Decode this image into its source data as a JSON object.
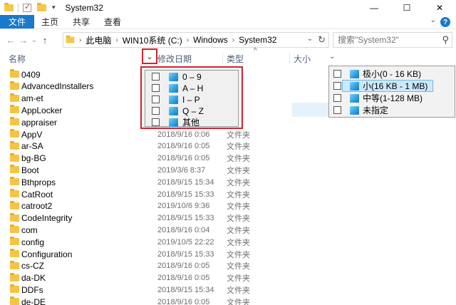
{
  "window": {
    "title": "System32",
    "controls": {
      "minimize": "—",
      "maximize": "☐",
      "close": "✕"
    }
  },
  "ribbon": {
    "tabs": [
      "文件",
      "主页",
      "共享",
      "查看"
    ],
    "help_label": "?",
    "collapse_label": "⌄"
  },
  "nav": {
    "back": "←",
    "forward": "→",
    "recent": "⌄",
    "up": "↑",
    "breadcrumbs": [
      "此电脑",
      "WIN10系统 (C:)",
      "Windows",
      "System32"
    ],
    "crumb_sep": "›",
    "dropdown": "⌄",
    "refresh": "↻"
  },
  "search": {
    "placeholder": "搜索\"System32\"",
    "icon": "⚲"
  },
  "columns": {
    "name": "名称",
    "date": "修改日期",
    "type": "类型",
    "size": "大小",
    "filter_caret": "⌄",
    "sort_caret": "^"
  },
  "files": [
    {
      "name": "0409",
      "date": "",
      "type": ""
    },
    {
      "name": "AdvancedInstallers",
      "date": "",
      "type": ""
    },
    {
      "name": "am-et",
      "date": "",
      "type": ""
    },
    {
      "name": "AppLocker",
      "date": "",
      "type": ""
    },
    {
      "name": "appraiser",
      "date": "",
      "type": ""
    },
    {
      "name": "AppV",
      "date": "2018/9/16 0:06",
      "type": "文件夹"
    },
    {
      "name": "ar-SA",
      "date": "2018/9/16 0:05",
      "type": "文件夹"
    },
    {
      "name": "bg-BG",
      "date": "2018/9/16 0:05",
      "type": "文件夹"
    },
    {
      "name": "Boot",
      "date": "2019/3/6 8:37",
      "type": "文件夹"
    },
    {
      "name": "Bthprops",
      "date": "2018/9/15 15:34",
      "type": "文件夹"
    },
    {
      "name": "CatRoot",
      "date": "2018/9/15 15:33",
      "type": "文件夹"
    },
    {
      "name": "catroot2",
      "date": "2019/10/6 9:36",
      "type": "文件夹"
    },
    {
      "name": "CodeIntegrity",
      "date": "2018/9/15 15:33",
      "type": "文件夹"
    },
    {
      "name": "com",
      "date": "2018/9/16 0:04",
      "type": "文件夹"
    },
    {
      "name": "config",
      "date": "2019/10/5 22:22",
      "type": "文件夹"
    },
    {
      "name": "Configuration",
      "date": "2018/9/15 15:33",
      "type": "文件夹"
    },
    {
      "name": "cs-CZ",
      "date": "2018/9/16 0:05",
      "type": "文件夹"
    },
    {
      "name": "da-DK",
      "date": "2018/9/16 0:05",
      "type": "文件夹"
    },
    {
      "name": "DDFs",
      "date": "2018/9/15 15:34",
      "type": "文件夹"
    },
    {
      "name": "de-DE",
      "date": "2018/9/16 0:05",
      "type": "文件夹"
    }
  ],
  "date_filter": {
    "options": [
      {
        "label": "0 – 9",
        "checked": false
      },
      {
        "label": "A – H",
        "checked": false
      },
      {
        "label": "I – P",
        "checked": false
      },
      {
        "label": "Q – Z",
        "checked": false
      },
      {
        "label": "其他",
        "checked": false
      }
    ]
  },
  "size_filter": {
    "options": [
      {
        "label": "极小(0 - 16 KB)",
        "checked": false,
        "selected": false
      },
      {
        "label": "小(16 KB - 1 MB)",
        "checked": false,
        "selected": true
      },
      {
        "label": "中等(1-128 MB)",
        "checked": false,
        "selected": false
      },
      {
        "label": "未指定",
        "checked": false,
        "selected": false
      }
    ]
  },
  "colors": {
    "accent": "#1979ca",
    "highlight_border": "#d2222d",
    "folder": "#f6c445",
    "header_text": "#4c607a",
    "selection": "#cce8fb"
  }
}
